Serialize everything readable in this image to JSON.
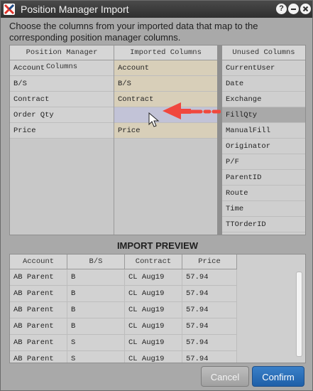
{
  "window": {
    "title": "Position Manager Import",
    "help_label": "?"
  },
  "instructions": "Choose the columns from your imported data that map to the corresponding position manager columns.",
  "mapping": {
    "pm_header": "Position Manager Columns",
    "imported_header": "Imported Columns",
    "rows": [
      {
        "pm": "Account",
        "imported": "Account"
      },
      {
        "pm": "B/S",
        "imported": "B/S"
      },
      {
        "pm": "Contract",
        "imported": "Contract"
      },
      {
        "pm": "Order Qty",
        "imported": ""
      },
      {
        "pm": "Price",
        "imported": "Price"
      }
    ]
  },
  "unused": {
    "header": "Unused Columns",
    "items": [
      "CurrentUser",
      "Date",
      "Exchange",
      "FillQty",
      "ManualFill",
      "Originator",
      "P/F",
      "ParentID",
      "Route",
      "Time",
      "TTOrderID"
    ]
  },
  "preview": {
    "title": "IMPORT PREVIEW",
    "headers": [
      "Account",
      "B/S",
      "Contract",
      "Price"
    ],
    "rows": [
      [
        "AB Parent",
        "B",
        "CL Aug19",
        "57.94"
      ],
      [
        "AB Parent",
        "B",
        "CL Aug19",
        "57.94"
      ],
      [
        "AB Parent",
        "B",
        "CL Aug19",
        "57.94"
      ],
      [
        "AB Parent",
        "B",
        "CL Aug19",
        "57.94"
      ],
      [
        "AB Parent",
        "S",
        "CL Aug19",
        "57.94"
      ],
      [
        "AB Parent",
        "S",
        "CL Aug19",
        "57.94"
      ]
    ]
  },
  "buttons": {
    "cancel": "Cancel",
    "confirm": "Confirm"
  },
  "colors": {
    "arrow": "#f0473e",
    "confirm": "#2a6fbd"
  },
  "icons": {
    "app": "app-logo-icon",
    "help": "help-icon",
    "minimize": "minimize-icon",
    "close": "close-icon",
    "cursor": "mouse-cursor-icon",
    "arrow": "drag-arrow-icon"
  }
}
